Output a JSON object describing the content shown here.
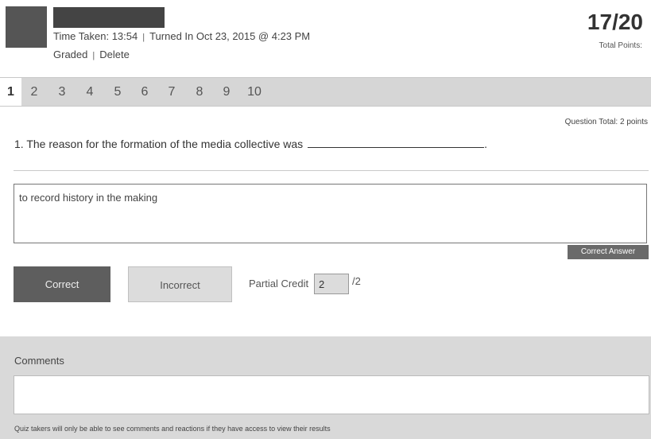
{
  "header": {
    "meta": {
      "time_taken": "Time Taken: 13:54",
      "separator": "|",
      "turned_in": "Turned In Oct 23, 2015 @ 4:23 PM"
    },
    "actions": {
      "graded": "Graded",
      "separator": "|",
      "delete": "Delete"
    },
    "score": "17/20",
    "score_label": "Total Points:"
  },
  "tabs": [
    {
      "label": "1",
      "active": true
    },
    {
      "label": "2"
    },
    {
      "label": "3"
    },
    {
      "label": "4"
    },
    {
      "label": "5"
    },
    {
      "label": "6"
    },
    {
      "label": "7"
    },
    {
      "label": "8"
    },
    {
      "label": "9"
    },
    {
      "label": "10"
    }
  ],
  "question": {
    "total": "Question Total: 2 points",
    "text": "1. The reason for the formation of the media collective was",
    "end_punct": "."
  },
  "answer": {
    "text": "to record history in the making",
    "badge": "Correct Answer"
  },
  "grading": {
    "correct_label": "Correct",
    "incorrect_label": "Incorrect",
    "partial_label": "Partial Credit",
    "partial_value": "2",
    "partial_max": "/2"
  },
  "comments": {
    "label": "Comments",
    "value": "",
    "note": "Quiz takers will only be able to see comments and reactions if they have access to view their results"
  },
  "colors": {
    "dark_button": "#5e5e5e",
    "tab_bar": "#d6d6d6",
    "comments_panel": "#d9d9d9"
  }
}
